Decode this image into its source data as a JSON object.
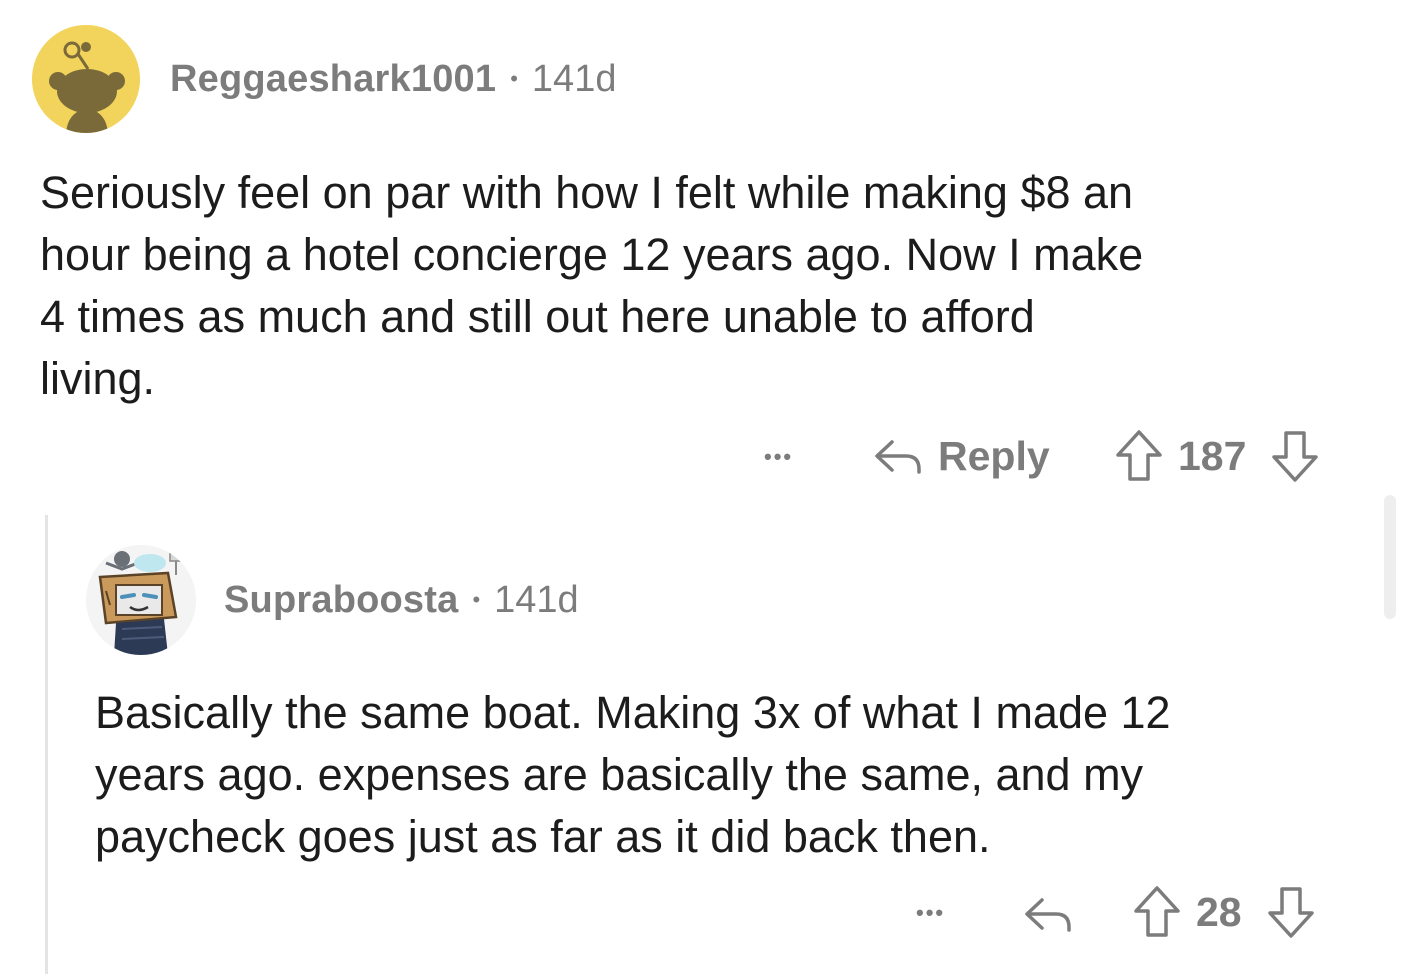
{
  "comments": [
    {
      "username": "Reggaeshark1001",
      "separator": "•",
      "age": "141d",
      "body_lines": [
        "Seriously feel on par with how I felt while making $8 an",
        "hour being a hotel concierge 12 years ago. Now I make",
        "4 times as much and still out here unable to afford",
        "living."
      ],
      "more_label": "•••",
      "reply_label": "Reply",
      "score": "187",
      "avatar_color": "#f2d45c"
    },
    {
      "username": "Supraboosta",
      "separator": "•",
      "age": "141d",
      "body_lines": [
        "Basically the same boat. Making 3x of what I made 12",
        "years ago. expenses are basically the same, and my",
        "paycheck goes just as far as it did back then."
      ],
      "more_label": "•••",
      "score": "28"
    }
  ],
  "icons": {
    "reply": "reply-arrow-icon",
    "upvote": "upvote-arrow-icon",
    "downvote": "downvote-arrow-icon"
  }
}
